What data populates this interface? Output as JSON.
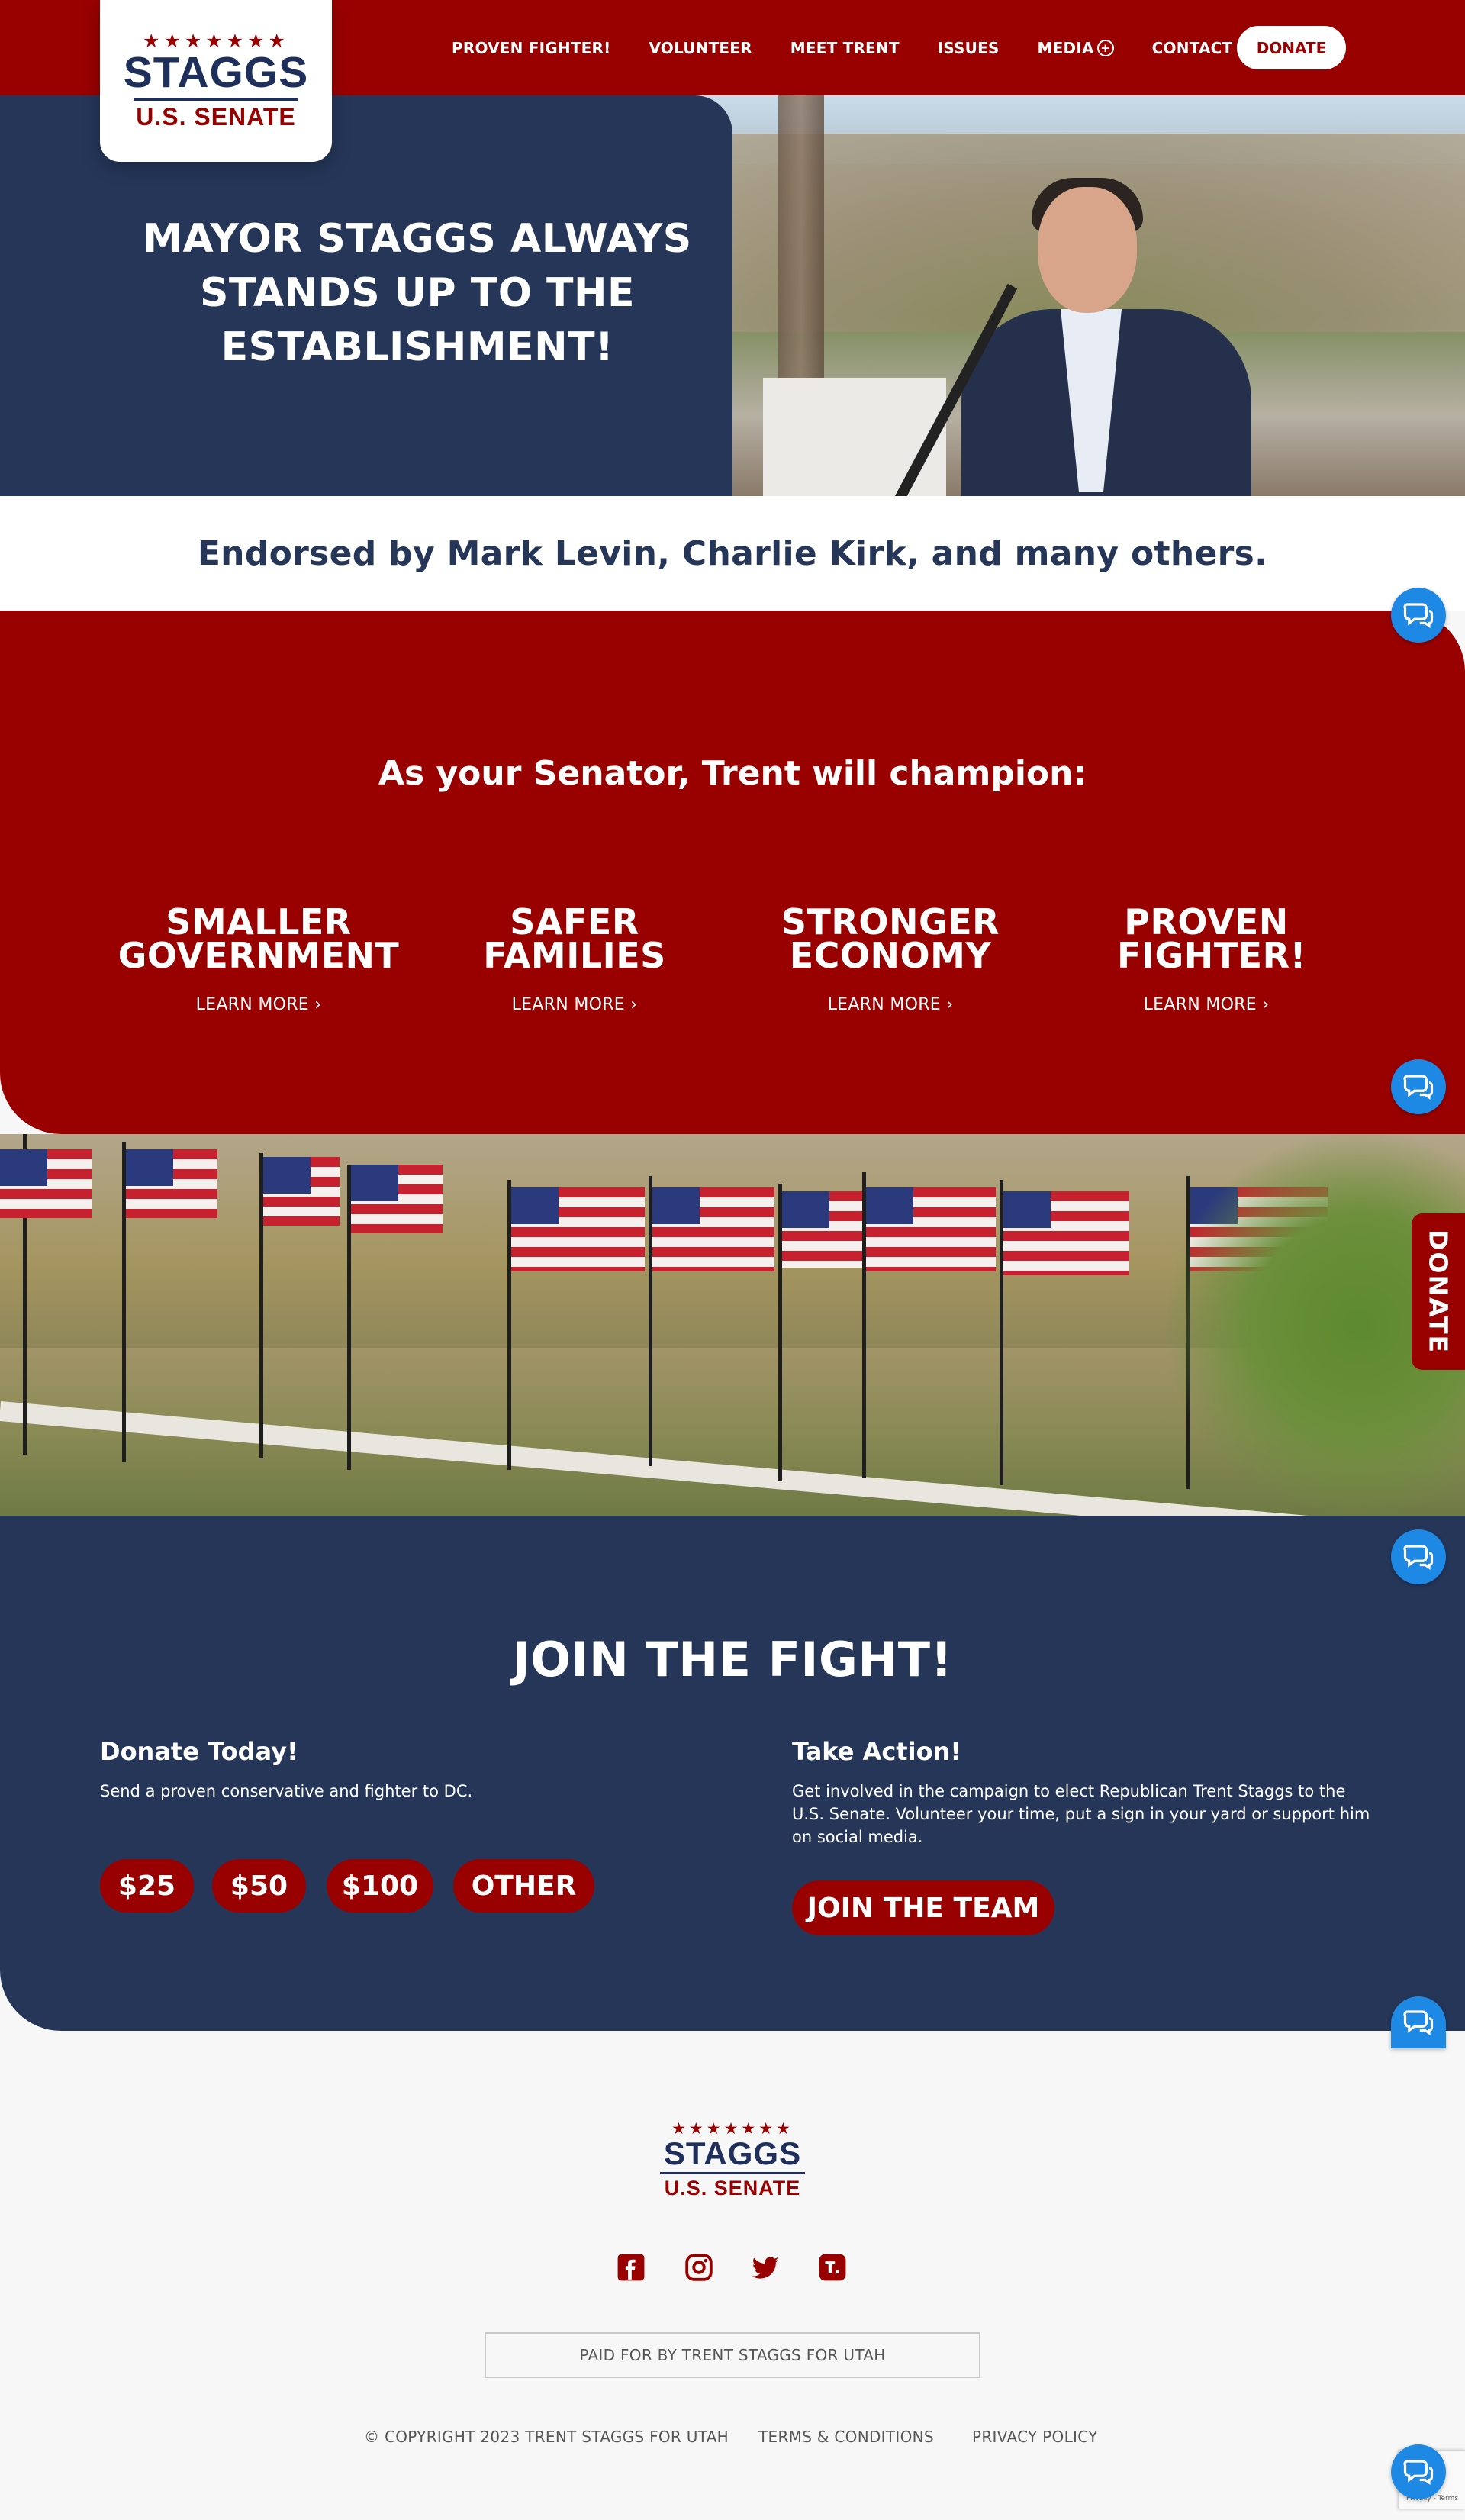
{
  "brand": {
    "stars": "★★★★★★★",
    "name": "STAGGS",
    "subtitle": "U.S. SENATE",
    "primary_color": "#990000",
    "navy_color": "#253659"
  },
  "nav": {
    "items": [
      {
        "label": "PROVEN FIGHTER!"
      },
      {
        "label": "VOLUNTEER"
      },
      {
        "label": "MEET TRENT"
      },
      {
        "label": "ISSUES"
      },
      {
        "label": "MEDIA"
      },
      {
        "label": "CONTACT"
      }
    ],
    "media_icon": "plus-circle-icon",
    "donate_label": "DONATE"
  },
  "hero": {
    "title": "MAYOR STAGGS ALWAYS STANDS UP TO THE ESTABLISHMENT!"
  },
  "endorse": {
    "text": "Endorsed by Mark Levin, Charlie Kirk, and many others."
  },
  "champion": {
    "title": "As your Senator, Trent will champion:",
    "pillars": [
      {
        "name": "SMALLER GOVERNMENT",
        "link": "LEARN MORE ›"
      },
      {
        "name": "SAFER FAMILIES",
        "link": "LEARN MORE ›"
      },
      {
        "name": "STRONGER ECONOMY",
        "link": "LEARN MORE ›"
      },
      {
        "name": "PROVEN FIGHTER!",
        "link": "LEARN MORE ›"
      }
    ]
  },
  "join": {
    "title": "JOIN THE FIGHT!",
    "donate": {
      "heading": "Donate Today!",
      "text": "Send a proven conservative and fighter to DC.",
      "amounts": [
        "$25",
        "$50",
        "$100",
        "OTHER"
      ]
    },
    "action": {
      "heading": "Take Action!",
      "text": "Get involved in the campaign to elect Republican Trent Staggs to the U.S. Senate. Volunteer your time, put a sign in your yard or support him on social media.",
      "button": "JOIN THE TEAM"
    }
  },
  "footer": {
    "social": [
      "facebook-icon",
      "instagram-icon",
      "twitter-icon",
      "truth-social-icon"
    ],
    "paid_for": "PAID FOR BY TRENT STAGGS FOR UTAH",
    "copyright": "© COPYRIGHT 2023 TRENT STAGGS FOR UTAH",
    "terms": "TERMS & CONDITIONS",
    "privacy": "PRIVACY POLICY"
  },
  "side_donate": "DONATE",
  "recaptcha_text": "Privacy - Terms"
}
